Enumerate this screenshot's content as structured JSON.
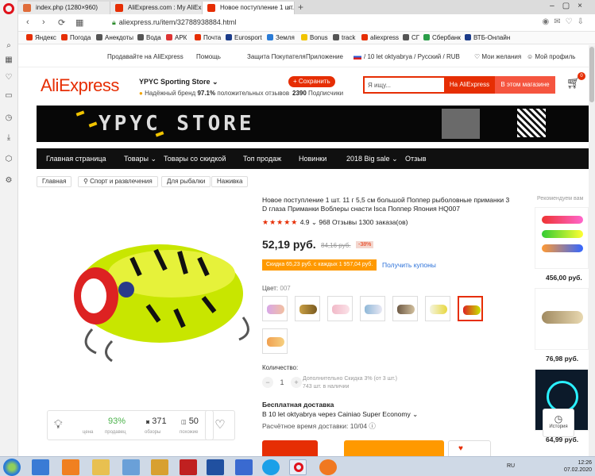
{
  "browser": {
    "tabs": [
      {
        "label": "index.php (1280×960)",
        "color": "#e06c3a",
        "active": false
      },
      {
        "label": "AliExpress.com : My AliExp",
        "color": "#e62e04",
        "active": false
      },
      {
        "label": "Новое поступление 1 шт.",
        "color": "#e62e04",
        "active": true
      }
    ],
    "url": "aliexpress.ru/item/32788938884.html",
    "bookmarks": [
      {
        "label": "Яндекс",
        "color": "#e62e04"
      },
      {
        "label": "Погода",
        "color": "#e62e04"
      },
      {
        "label": "Анекдоты",
        "color": "#555555"
      },
      {
        "label": "Вода",
        "color": "#555555"
      },
      {
        "label": "АРК",
        "color": "#d33"
      },
      {
        "label": "Почта",
        "color": "#e62e04"
      },
      {
        "label": "Eurosport",
        "color": "#1c3c8a"
      },
      {
        "label": "Земля",
        "color": "#2a7bd6"
      },
      {
        "label": "Bonus",
        "color": "#f1c400"
      },
      {
        "label": "track",
        "color": "#555555"
      },
      {
        "label": "aliexpress",
        "color": "#e62e04"
      },
      {
        "label": "СГ",
        "color": "#555555"
      },
      {
        "label": "Сбербанк",
        "color": "#2a9d48"
      },
      {
        "label": "ВТБ-Онлайн",
        "color": "#1c3c8a"
      }
    ]
  },
  "topnav": {
    "sell": "Продавайте на AliExpress",
    "help": "Помощь",
    "protection": "Защита Покупателя",
    "app": "Приложение",
    "locale": "/ 10 let oktyabrya / Русский / RUB",
    "wishlist": "Мои желания",
    "profile": "Мой профиль"
  },
  "header": {
    "logo": "AliExpress",
    "store_name": "YPYC Sporting Store",
    "brand_label": "Надёжный бренд",
    "brand_pct": "97.1%",
    "brand_tail": "положительных отзывов",
    "save_label": "+ Сохранить",
    "subs_count": "2390",
    "subs_label": "Подписчики",
    "search_placeholder": "Я ищу...",
    "search_all": "На AliExpress",
    "search_store": "В этом магазине",
    "cart_count": "0"
  },
  "banner": {
    "title": "YPYC STORE"
  },
  "storenav": [
    "Главная страница",
    "Товары",
    "Товары со скидкой",
    "Топ продаж",
    "Новинки",
    "2018 Big sale",
    "Отзыв"
  ],
  "breadcrumbs": [
    "Главная",
    "Спорт и развлечения",
    "Для рыбалки",
    "Наживка"
  ],
  "product": {
    "title": "Новое поступление 1 шт. 11 г 5,5 см большой Поппер рыболовные приманки 3 D глаза Приманки Воблеры снасти Isca Поппер Япония HQ007",
    "stars": "★★★★★",
    "rating": "4.9",
    "reviews": "968 Отзывы",
    "orders": "1300 заказа(ов)",
    "price": "52,19 руб.",
    "old_price": "84,16 руб.",
    "discount": "-38%",
    "coupon": "Скидка 65,23 руб. с каждых 1 957,04 руб.",
    "coupon_link": "Получить купоны",
    "color_label": "Цвет:",
    "color_value": "007",
    "qty_label": "Количество:",
    "qty_value": "1",
    "qty_note_1": "Дополнительно Скидка 3% (от 3 шт.)",
    "qty_note_2": "743 шт. в наличии",
    "ship_title": "Бесплатная доставка",
    "ship_line": "В 10 let oktyabrya через Cainiao Super Economy",
    "ship_time": "Расчётное время доставки: 10/04"
  },
  "stats": {
    "price_label": "цена",
    "pct": "93%",
    "pct_label": "продавец",
    "reviews": "371",
    "reviews_label": "обзоры",
    "similar": "50",
    "similar_label": "похожие"
  },
  "recommended": {
    "title": "Рекомендуем вам",
    "prices": [
      "456,00 руб.",
      "76,98 руб.",
      "64,99 руб."
    ]
  },
  "history_label": "История",
  "taskbar": {
    "lang": "RU",
    "time": "12:26",
    "date": "07.02.2020"
  }
}
